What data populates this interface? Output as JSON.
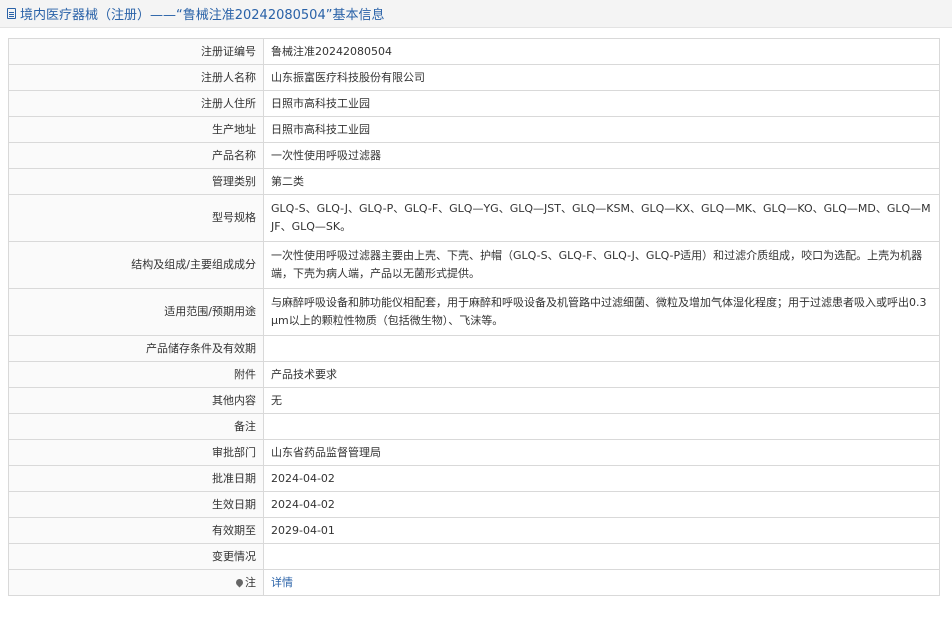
{
  "header": {
    "title": "境内医疗器械（注册）——“鲁械注准20242080504”基本信息"
  },
  "rows": [
    {
      "label": "注册证编号",
      "value": "鲁械注准20242080504"
    },
    {
      "label": "注册人名称",
      "value": "山东振富医疗科技股份有限公司"
    },
    {
      "label": "注册人住所",
      "value": "日照市高科技工业园"
    },
    {
      "label": "生产地址",
      "value": "日照市高科技工业园"
    },
    {
      "label": "产品名称",
      "value": "一次性使用呼吸过滤器"
    },
    {
      "label": "管理类别",
      "value": "第二类"
    },
    {
      "label": "型号规格",
      "value": "GLQ-S、GLQ-J、GLQ-P、GLQ-F、GLQ—YG、GLQ—JST、GLQ—KSM、GLQ—KX、GLQ—MK、GLQ—KO、GLQ—MD、GLQ—MJF、GLQ—SK。"
    },
    {
      "label": "结构及组成/主要组成成分",
      "value": "一次性使用呼吸过滤器主要由上壳、下壳、护帽（GLQ-S、GLQ-F、GLQ-J、GLQ-P适用）和过滤介质组成，咬口为选配。上壳为机器端，下壳为病人端，产品以无菌形式提供。"
    },
    {
      "label": "适用范围/预期用途",
      "value": "与麻醉呼吸设备和肺功能仪相配套，用于麻醉和呼吸设备及机管路中过滤细菌、微粒及增加气体湿化程度；用于过滤患者吸入或呼出0.3μm以上的颗粒性物质（包括微生物）、飞沫等。"
    },
    {
      "label": "产品储存条件及有效期",
      "value": ""
    },
    {
      "label": "附件",
      "value": "产品技术要求"
    },
    {
      "label": "其他内容",
      "value": "无"
    },
    {
      "label": "备注",
      "value": ""
    },
    {
      "label": "审批部门",
      "value": "山东省药品监督管理局"
    },
    {
      "label": "批准日期",
      "value": "2024-04-02"
    },
    {
      "label": "生效日期",
      "value": "2024-04-02"
    },
    {
      "label": "有效期至",
      "value": "2029-04-01"
    },
    {
      "label": "变更情况",
      "value": ""
    }
  ],
  "note": {
    "label": "注",
    "link_text": "详情"
  },
  "icons": {
    "header_icon": "document-icon",
    "note_icon": "pin-icon"
  },
  "colors": {
    "link": "#2a62a8",
    "border": "#d9d9d9",
    "header_bg": "#f4f4f4"
  }
}
